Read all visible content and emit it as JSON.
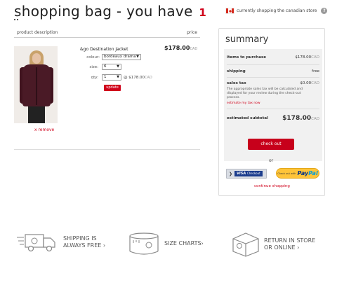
{
  "header": {
    "title": "shopping bag - you have",
    "count": "1",
    "store_text": "currently shopping the canadian store",
    "help": "?"
  },
  "columns": {
    "description": "product description",
    "price": "price"
  },
  "item": {
    "name": "&go Destination Jacket",
    "price": "$178.00",
    "currency": "CAD",
    "colour_label": "colour:",
    "colour_value": "bordeaux drama",
    "size_label": "size:",
    "size_value": "6",
    "qty_label": "qty:",
    "qty_value": "1",
    "unit_price_prefix": "@",
    "unit_price": "$178.00",
    "unit_currency": "CAD",
    "update_label": "update",
    "remove_label": "x remove"
  },
  "summary": {
    "title": "summary",
    "items_label": "items to purchase",
    "items_value": "$178.00",
    "items_currency": "CAD",
    "shipping_label": "shipping",
    "shipping_value": "free",
    "tax_label": "sales tax",
    "tax_value": "$0.00",
    "tax_currency": "CAD",
    "tax_note": "The appropriate sales tax will be calculated and displayed for your review during the check-out process.",
    "tax_link": "estimate my tax now",
    "subtotal_label": "estimated subtotal",
    "subtotal_value": "$178.00",
    "subtotal_currency": "CAD"
  },
  "actions": {
    "checkout": "check out",
    "or": "or",
    "visa": "VISA",
    "visa_sub": "Checkout",
    "paypal_pre": "Check out with",
    "paypal_pay": "Pay",
    "paypal_pal": "Pal",
    "continue": "continue shopping"
  },
  "features": [
    {
      "line1": "SHIPPING IS",
      "line2": "ALWAYS FREE",
      "icon": "truck-icon"
    },
    {
      "line1": "SIZE CHARTS",
      "line2": "",
      "icon": "measuring-tape-icon"
    },
    {
      "line1": "RETURN IN STORE",
      "line2": "OR ONLINE",
      "icon": "box-icon"
    }
  ],
  "colors": {
    "accent": "#d0021b",
    "checkout_btn": "#c7001b",
    "paypal_yellow": "#ffc439",
    "visa_blue": "#1a3b8c"
  }
}
